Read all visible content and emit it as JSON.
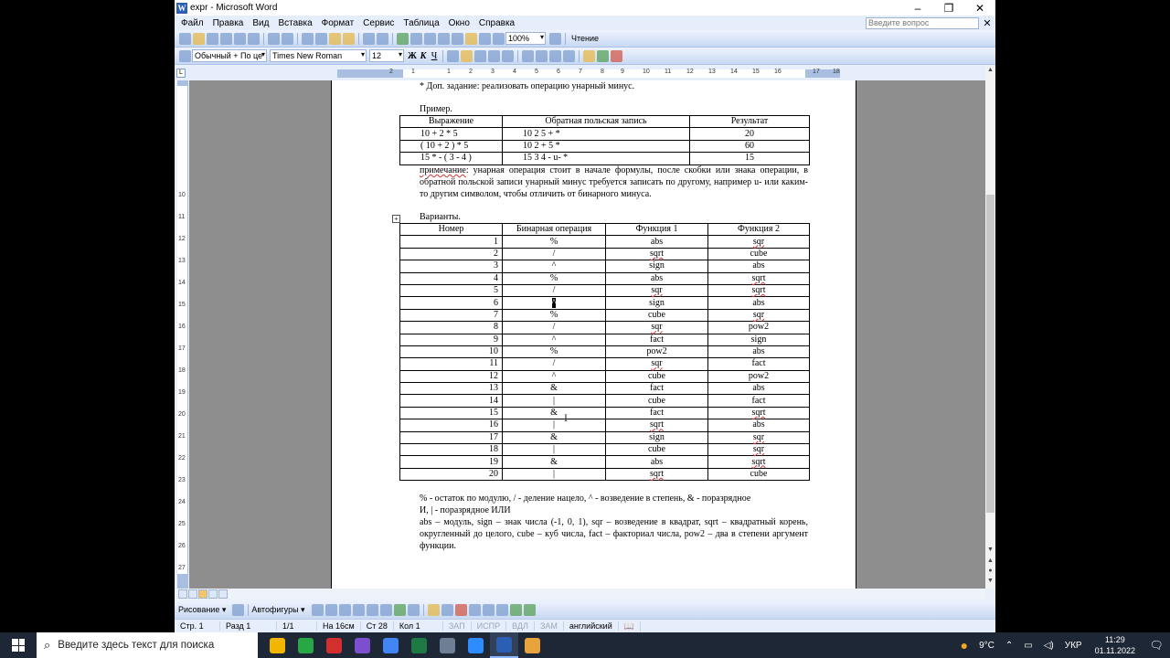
{
  "window": {
    "title": "expr - Microsoft Word",
    "minimize": "–",
    "maximize": "❐",
    "close": "✕"
  },
  "menu": {
    "items": [
      "Файл",
      "Правка",
      "Вид",
      "Вставка",
      "Формат",
      "Сервис",
      "Таблица",
      "Окно",
      "Справка"
    ],
    "ask_placeholder": "Введите вопрос",
    "close_doc": "✕"
  },
  "toolbar_std": {
    "zoom": "100%",
    "reading": "Чтение"
  },
  "toolbar_fmt": {
    "style": "Обычный + По це",
    "font": "Times New Roman",
    "size": "12",
    "bold": "Ж",
    "italic": "К",
    "underline": "Ч"
  },
  "ruler": {
    "corner": "L",
    "numbers": [
      "2",
      "1",
      "1",
      "2",
      "3",
      "4",
      "5",
      "6",
      "7",
      "8",
      "9",
      "10",
      "11",
      "12",
      "13",
      "14",
      "15",
      "16",
      "17",
      "18"
    ]
  },
  "vruler": {
    "numbers": [
      "10",
      "11",
      "12",
      "13",
      "14",
      "15",
      "16",
      "17",
      "18",
      "19",
      "20",
      "21",
      "22",
      "23",
      "24",
      "25",
      "26",
      "27"
    ]
  },
  "doc": {
    "extra_task": "* Доп. задание: реализовать операцию унарный минус.",
    "example_label": "Пример.",
    "example_table": {
      "headers": [
        "Выражение",
        "Обратная польская запись",
        "Результат"
      ],
      "rows": [
        [
          "10 + 2 * 5",
          "10 2 5 + *",
          "20"
        ],
        [
          "( 10 + 2 ) * 5",
          "10 2 + 5 *",
          "60"
        ],
        [
          "15 * - ( 3 - 4 )",
          "15 3 4 - u- *",
          "15"
        ]
      ]
    },
    "note_word": "примечание",
    "note_rest": ": унарная операция стоит в начале формулы, после скобки или знака операции, в обратной польской записи унарный минус требуется записать по другому, например u- или каким-то другим символом, чтобы отличить от бинарного минуса.",
    "variants_label": "Варианты.",
    "variants_table": {
      "headers": [
        "Номер",
        "Бинарная операция",
        "Функция 1",
        "Функция 2"
      ],
      "rows": [
        [
          "1",
          "%",
          "abs",
          "sqr"
        ],
        [
          "2",
          "/",
          "sqrt",
          "cube"
        ],
        [
          "3",
          "^",
          "sign",
          "abs"
        ],
        [
          "4",
          "%",
          "abs",
          "sqrt"
        ],
        [
          "5",
          "/",
          "sqr",
          "sqrt"
        ],
        [
          "6",
          "^",
          "sign",
          "abs"
        ],
        [
          "7",
          "%",
          "cube",
          "sqr"
        ],
        [
          "8",
          "/",
          "sqr",
          "pow2"
        ],
        [
          "9",
          "^",
          "fact",
          "sign"
        ],
        [
          "10",
          "%",
          "pow2",
          "abs"
        ],
        [
          "11",
          "/",
          "sqr",
          "fact"
        ],
        [
          "12",
          "^",
          "cube",
          "pow2"
        ],
        [
          "13",
          "&",
          "fact",
          "abs"
        ],
        [
          "14",
          "|",
          "cube",
          "fact"
        ],
        [
          "15",
          "&",
          "fact",
          "sqrt"
        ],
        [
          "16",
          "|",
          "sqrt",
          "abs"
        ],
        [
          "17",
          "&",
          "sign",
          "sqr"
        ],
        [
          "18",
          "|",
          "cube",
          "sqr"
        ],
        [
          "19",
          "&",
          "abs",
          "sqrt"
        ],
        [
          "20",
          "|",
          "sqrt",
          "cube"
        ]
      ]
    },
    "legend_line1": "% - остаток по модулю, / - деление нацело, ^ - возведение в степень, & - поразрядное",
    "legend_line2": "И, | - поразрядное ИЛИ",
    "legend_p2": "abs – модуль, sign – знак числа (-1, 0, 1), sqr – возведение в квадрат, sqrt – квадратный корень, округленный до целого, cube – куб числа, fact – факториал числа, pow2 – два в степени аргумент функции."
  },
  "drawbar": {
    "drawing": "Рисование ▾",
    "autoshapes": "Автофигуры ▾"
  },
  "status": {
    "page": "Стр. 1",
    "section": "Разд 1",
    "pages": "1/1",
    "at": "На 16см",
    "line": "Ст 28",
    "col": "Кол 1",
    "rec": "ЗАП",
    "trk": "ИСПР",
    "ext": "ВДЛ",
    "ovr": "ЗАМ",
    "lang": "английский"
  },
  "taskbar": {
    "search_placeholder": "Введите здесь текст для поиска",
    "weather": "9°C",
    "lang": "УКР",
    "time": "11:29",
    "date": "01.11.2022",
    "colors": [
      "#f2b600",
      "#28a745",
      "#d32f2f",
      "#7b4fd0",
      "#4285f4",
      "#1d7a45",
      "#6e7f95",
      "#2d8cff",
      "#2b5fb4",
      "#e8a33d"
    ]
  }
}
